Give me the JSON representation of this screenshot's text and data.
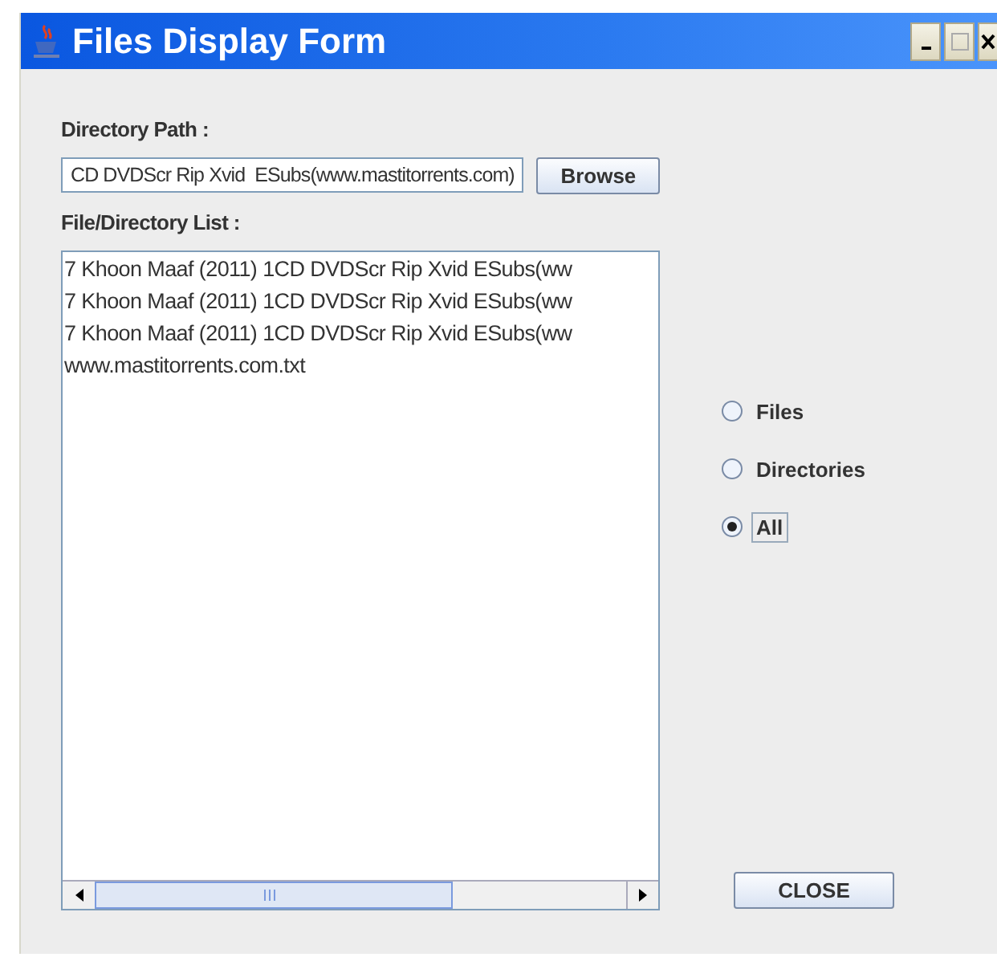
{
  "window": {
    "title": "Files Display Form"
  },
  "directory_path": {
    "label": "Directory Path :",
    "value": "CD DVDScr Rip Xvid  ESubs(www.mastitorrents.com)"
  },
  "browse_button": "Browse",
  "list": {
    "label": "File/Directory List :",
    "items": [
      "7 Khoon Maaf (2011) 1CD DVDScr Rip Xvid  ESubs(ww",
      "7 Khoon Maaf (2011) 1CD DVDScr Rip Xvid  ESubs(ww",
      "7 Khoon Maaf (2011) 1CD DVDScr Rip Xvid  ESubs(ww",
      "www.mastitorrents.com.txt"
    ]
  },
  "filter": [
    {
      "label": "Files",
      "selected": false
    },
    {
      "label": "Directories",
      "selected": false
    },
    {
      "label": "All",
      "selected": true
    }
  ],
  "close_button": "CLOSE"
}
